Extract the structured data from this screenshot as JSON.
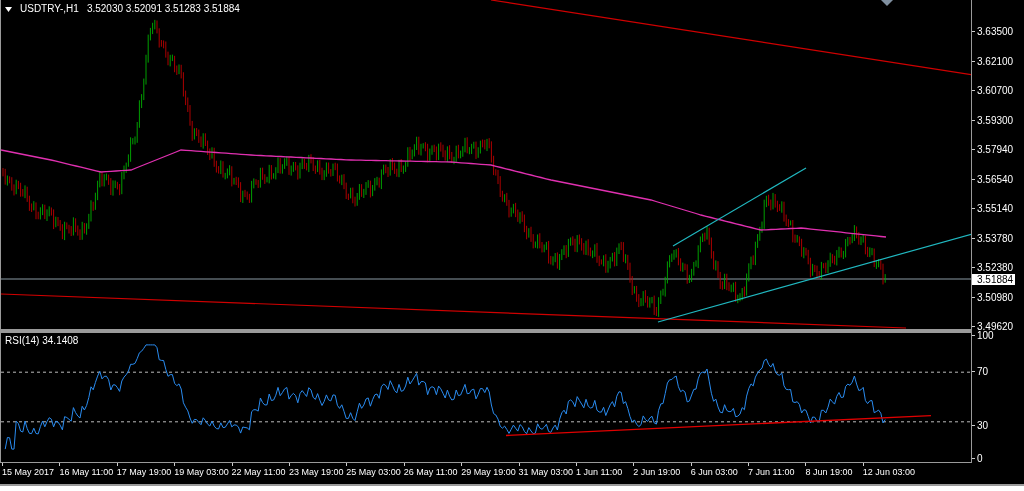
{
  "chart": {
    "symbol": "USDTRY-,H1",
    "quote": "3.52030 3.52091 3.51283 3.51884",
    "price_axis": [
      "3.63500",
      "3.62100",
      "3.60700",
      "3.59300",
      "3.57940",
      "3.56540",
      "3.55140",
      "3.53780",
      "3.52380",
      "3.50980",
      "3.49620"
    ],
    "current_price": "3.51884"
  },
  "indicator": {
    "title": "RSI(14) 34.1408",
    "axis": [
      "100",
      "70",
      "30",
      "0"
    ]
  },
  "time_axis": [
    "15 May 2017",
    "16 May 11:00",
    "17 May 19:00",
    "19 May 03:00",
    "22 May 11:00",
    "23 May 19:00",
    "25 May 03:00",
    "26 May 11:00",
    "29 May 19:00",
    "31 May 03:00",
    "1 Jun 11:00",
    "2 Jun 19:00",
    "6 Jun 03:00",
    "7 Jun 11:00",
    "8 Jun 19:00",
    "12 Jun 03:00"
  ]
}
